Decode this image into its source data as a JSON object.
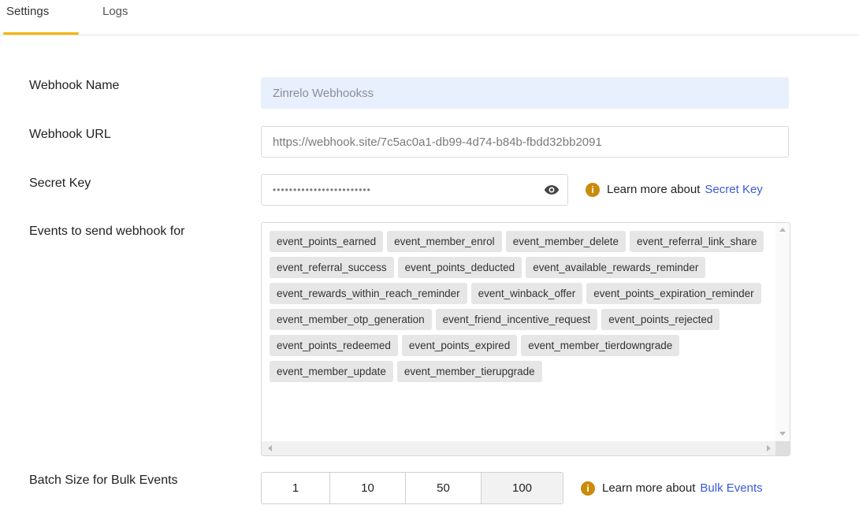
{
  "tabs": [
    {
      "label": "Settings",
      "active": true
    },
    {
      "label": "Logs",
      "active": false
    }
  ],
  "accent_color": "#f5b400",
  "form": {
    "webhook_name": {
      "label": "Webhook Name",
      "value": "Zinrelo Webhookss"
    },
    "webhook_url": {
      "label": "Webhook URL",
      "value": "https://webhook.site/7c5ac0a1-db99-4d74-b84b-fbdd32bb2091"
    },
    "secret_key": {
      "label": "Secret Key",
      "value": "••••••••••••••••••••••••",
      "toggle_icon": "eye-icon",
      "learn_text": "Learn more about",
      "learn_link": "Secret Key"
    },
    "events": {
      "label": "Events to send webhook for",
      "items": [
        "event_points_earned",
        "event_member_enrol",
        "event_member_delete",
        "event_referral_link_share",
        "event_referral_success",
        "event_points_deducted",
        "event_available_rewards_reminder",
        "event_rewards_within_reach_reminder",
        "event_winback_offer",
        "event_points_expiration_reminder",
        "event_member_otp_generation",
        "event_friend_incentive_request",
        "event_points_rejected",
        "event_points_redeemed",
        "event_points_expired",
        "event_member_tierdowngrade",
        "event_member_update",
        "event_member_tierupgrade"
      ]
    },
    "batch_size": {
      "label": "Batch Size for Bulk Events",
      "options": [
        "1",
        "10",
        "50",
        "100"
      ],
      "selected": "100",
      "learn_text": "Learn more about",
      "learn_link": "Bulk Events"
    }
  }
}
